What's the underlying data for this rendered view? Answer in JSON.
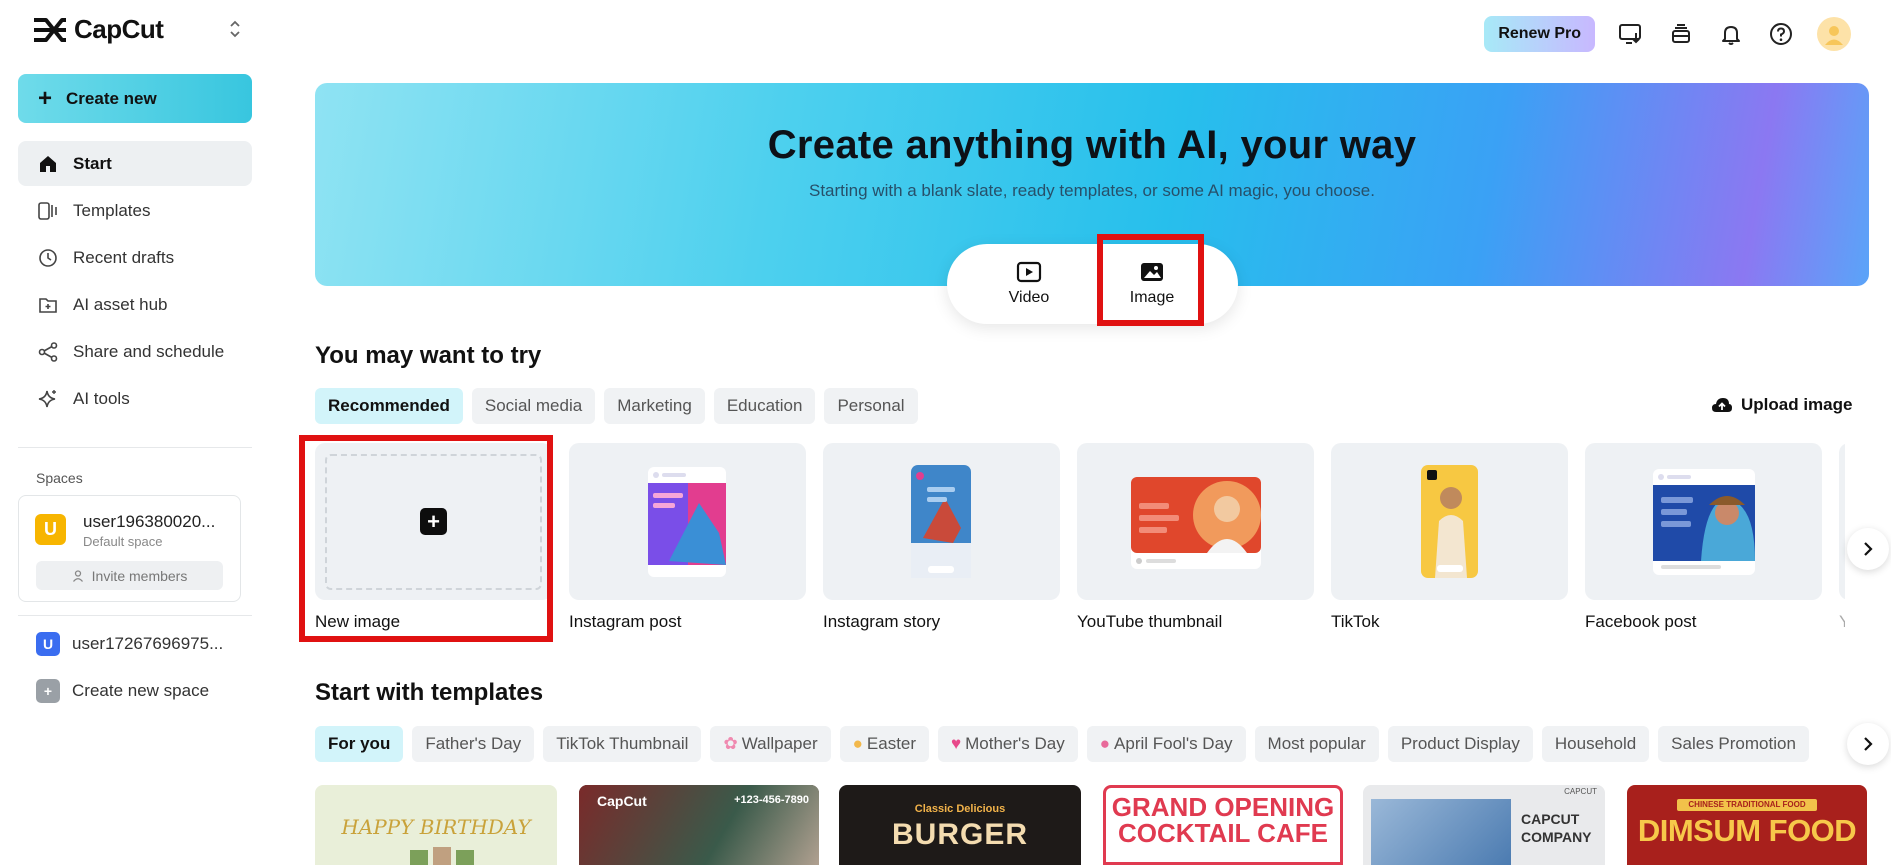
{
  "app": {
    "name": "CapCut"
  },
  "sidebar": {
    "create_label": "Create new",
    "items": [
      {
        "label": "Start",
        "icon": "home-icon",
        "active": true
      },
      {
        "label": "Templates",
        "icon": "templates-icon"
      },
      {
        "label": "Recent drafts",
        "icon": "clock-icon"
      },
      {
        "label": "AI asset hub",
        "icon": "asset-hub-icon"
      },
      {
        "label": "Share and schedule",
        "icon": "share-icon"
      },
      {
        "label": "AI tools",
        "icon": "sparkle-icon"
      }
    ],
    "spaces_title": "Spaces",
    "space": {
      "initial": "U",
      "name": "user196380020...",
      "sub": "Default space",
      "invite_label": "Invite members"
    },
    "other_space": {
      "initial": "U",
      "name": "user17267696975..."
    },
    "create_space_label": "Create new space"
  },
  "topbar": {
    "renew_label": "Renew Pro"
  },
  "hero": {
    "title": "Create anything with AI, your way",
    "subtitle": "Starting with a blank slate, ready templates, or some AI magic, you choose.",
    "modes": [
      {
        "label": "Video"
      },
      {
        "label": "Image"
      }
    ]
  },
  "try_section": {
    "title": "You may want to try",
    "chips": [
      "Recommended",
      "Social media",
      "Marketing",
      "Education",
      "Personal"
    ],
    "upload_label": "Upload image",
    "cards": [
      {
        "label": "New image"
      },
      {
        "label": "Instagram post"
      },
      {
        "label": "Instagram story"
      },
      {
        "label": "YouTube thumbnail"
      },
      {
        "label": "TikTok"
      },
      {
        "label": "Facebook post"
      },
      {
        "label": "Yo"
      }
    ]
  },
  "templates_section": {
    "title": "Start with templates",
    "chips": [
      "For you",
      "Father's Day",
      "TikTok Thumbnail",
      "Wallpaper",
      "Easter",
      "Mother's Day",
      "April Fool's Day",
      "Most popular",
      "Product Display",
      "Household",
      "Sales Promotion"
    ],
    "tiles": [
      {
        "text": "HAPPY BIRTHDAY"
      },
      {
        "text": "CapCut",
        "phone": "+123-456-7890"
      },
      {
        "text": "BURGER",
        "sub": "Classic Delicious"
      },
      {
        "text": "GRAND OPENING",
        "text2": "COCKTAIL CAFE"
      },
      {
        "text": "CAPCUT",
        "text2": "COMPANY",
        "tag": "CAPCUT"
      },
      {
        "text": "DIMSUM FOOD",
        "sub": "CHINESE TRADITIONAL FOOD"
      }
    ]
  },
  "colors": {
    "accent": "#38c6df",
    "highlight": "#e01111",
    "hero_start": "#8fe3f3",
    "hero_end": "#8b78f2"
  }
}
